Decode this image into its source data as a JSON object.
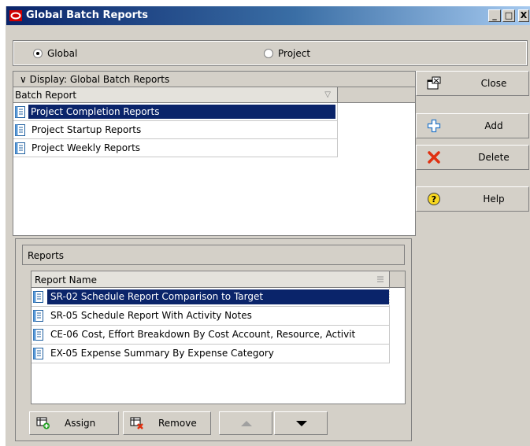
{
  "window": {
    "title": "Global Batch Reports",
    "controls": {
      "minimize": "_",
      "maximize": "□",
      "close": "X"
    }
  },
  "scope": {
    "options": [
      {
        "label": "Global",
        "selected": true
      },
      {
        "label": "Project",
        "selected": false
      }
    ]
  },
  "batch_reports": {
    "display_label": "∨ Display: Global Batch Reports",
    "column_header": "Batch Report",
    "sort_icon": "filter-triangle-icon",
    "rows": [
      {
        "label": "Project Completion Reports",
        "selected": true
      },
      {
        "label": "Project Startup Reports",
        "selected": false
      },
      {
        "label": "Project Weekly Reports",
        "selected": false
      }
    ]
  },
  "side_buttons": [
    {
      "label": "Close",
      "icon": "close-window-icon"
    },
    {
      "label": "Add",
      "icon": "add-plus-icon"
    },
    {
      "label": "Delete",
      "icon": "delete-x-icon"
    },
    {
      "label": "Help",
      "icon": "help-icon"
    }
  ],
  "reports": {
    "group_title": "Reports",
    "column_header": "Report Name",
    "rows": [
      {
        "label": "SR-02 Schedule Report Comparison to Target",
        "selected": true
      },
      {
        "label": "SR-05 Schedule Report With Activity Notes",
        "selected": false
      },
      {
        "label": "CE-06  Cost, Effort Breakdown By Cost Account, Resource, Activit",
        "selected": false
      },
      {
        "label": "EX-05  Expense Summary By Expense Category",
        "selected": false
      }
    ]
  },
  "bottom_buttons": {
    "assign": "Assign",
    "remove": "Remove"
  },
  "colors": {
    "title_start": "#0a246a",
    "title_end": "#a6caf0",
    "selection": "#0a246a",
    "face": "#d4d0c8"
  }
}
